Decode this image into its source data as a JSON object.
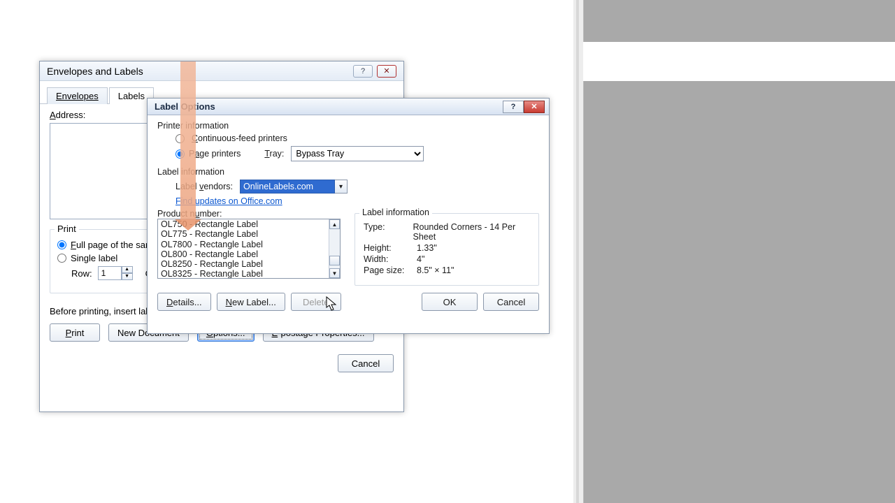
{
  "envDialog": {
    "title": "Envelopes and Labels",
    "tabs": {
      "envelopes": "Envelopes",
      "labels": "Labels"
    },
    "addressLabel": "Address:",
    "printGroup": {
      "legend": "Print",
      "fullPage": "Full page of the same label",
      "single": "Single label",
      "rowLabel": "Row:",
      "rowValue": "1",
      "colLabel": "C"
    },
    "hint": "Before printing, insert labels in your printer's manual feeder.",
    "buttons": {
      "print": "Print",
      "newDoc": "New Document",
      "options": "Options...",
      "epostage": "E-postage Properties...",
      "cancel": "Cancel"
    }
  },
  "optDialog": {
    "title": "Label Options",
    "printerInfo": "Printer information",
    "contFeed": "Continuous-feed printers",
    "pagePrinters": "Page printers",
    "trayLabel": "Tray:",
    "trayValue": "Bypass Tray",
    "labelInfoHdr": "Label information",
    "vendorLabel": "Label vendors:",
    "vendorValue": "OnlineLabels.com",
    "updatesLink": "Find updates on Office.com",
    "productLabel": "Product number:",
    "products": [
      "OL750 - Rectangle Label",
      "OL775 - Rectangle Label",
      "OL7800 - Rectangle Label",
      "OL800 - Rectangle Label",
      "OL8250 - Rectangle Label",
      "OL8325 - Rectangle Label"
    ],
    "infoGroup": {
      "legend": "Label information",
      "typeK": "Type:",
      "typeV": "Rounded Corners - 14 Per Sheet",
      "heightK": "Height:",
      "heightV": "1.33\"",
      "widthK": "Width:",
      "widthV": "4\"",
      "pageK": "Page size:",
      "pageV": "8.5\" × 11\""
    },
    "buttons": {
      "details": "Details...",
      "newLabel": "New Label...",
      "delete": "Delete",
      "ok": "OK",
      "cancel": "Cancel"
    }
  }
}
